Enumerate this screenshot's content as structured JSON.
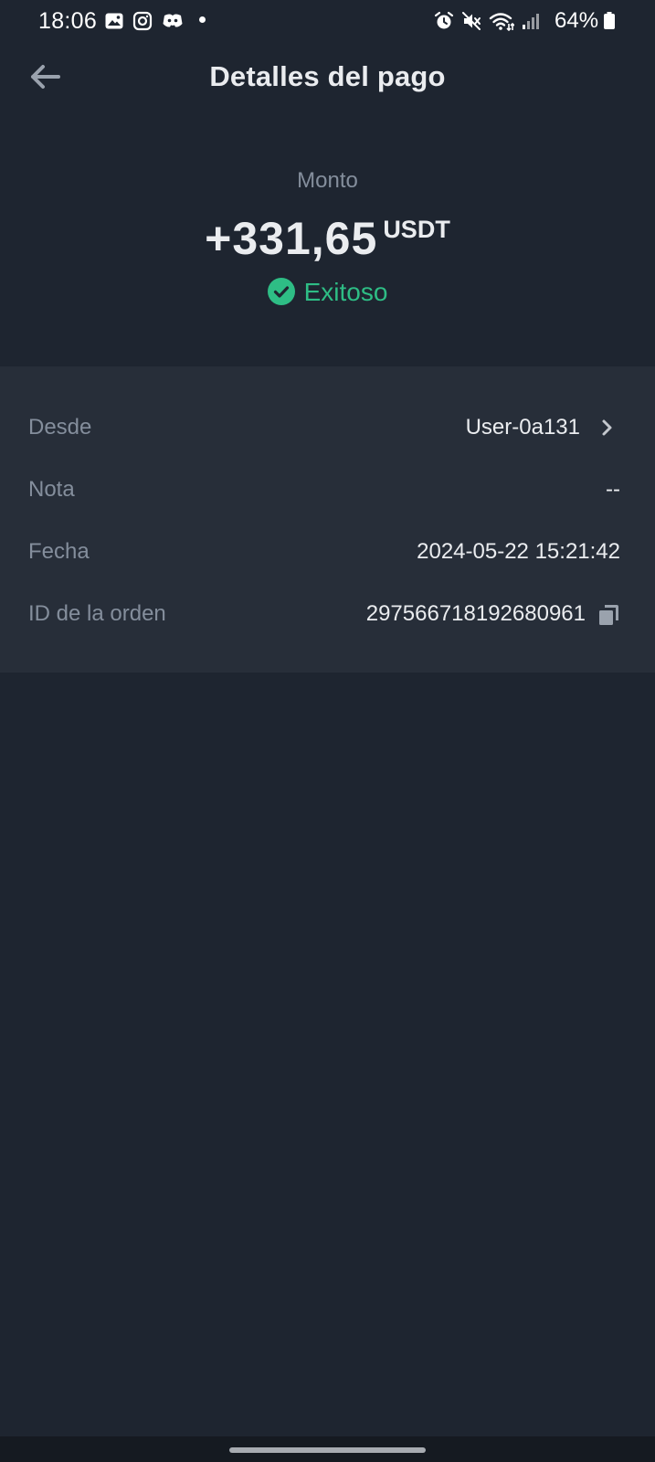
{
  "status_bar": {
    "time": "18:06",
    "battery": "64%",
    "left_icons": [
      "gallery-icon",
      "instagram-icon",
      "discord-icon"
    ],
    "right_icons": [
      "alarm-icon",
      "mute-icon",
      "wifi-icon",
      "signal-icon",
      "battery-icon"
    ]
  },
  "header": {
    "title": "Detalles del pago",
    "back_icon": "arrow-left-icon"
  },
  "amount": {
    "label": "Monto",
    "value": "+331,65",
    "unit": "USDT",
    "status": "Exitoso",
    "status_icon": "check-circle-icon"
  },
  "details": {
    "rows": [
      {
        "label": "Desde",
        "value": "User-0a131",
        "icon": "chevron-right-icon"
      },
      {
        "label": "Nota",
        "value": "--"
      },
      {
        "label": "Fecha",
        "value": "2024-05-22 15:21:42"
      },
      {
        "label": "ID de la orden",
        "value": "297566718192680961",
        "icon": "copy-icon"
      }
    ]
  },
  "colors": {
    "background": "#1e2530",
    "card": "#272e39",
    "primary_text": "#eaecef",
    "secondary_text": "#848e9c",
    "success": "#2ebd85"
  }
}
